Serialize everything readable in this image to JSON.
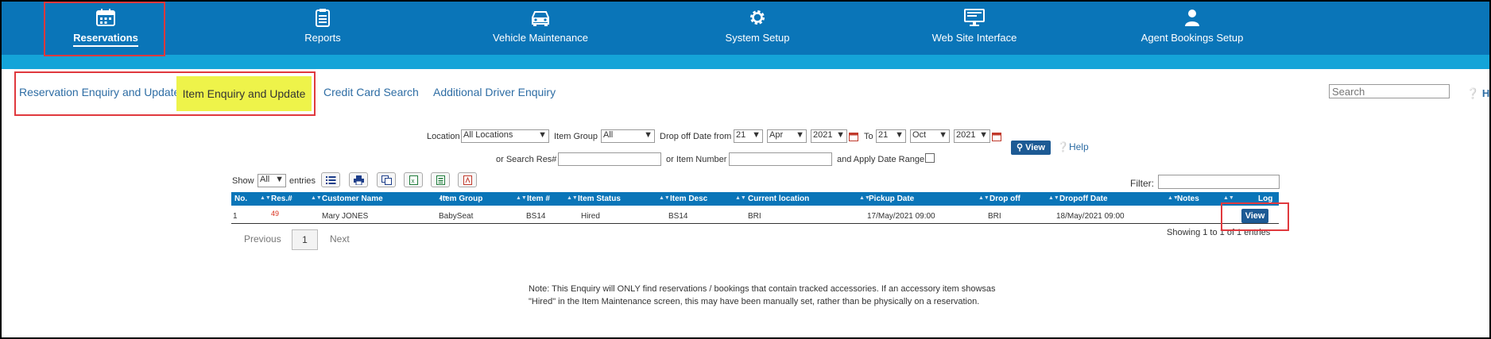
{
  "nav": [
    {
      "label": "Reservations",
      "icon": "calendar-icon",
      "active": true
    },
    {
      "label": "Reports",
      "icon": "clipboard-icon"
    },
    {
      "label": "Vehicle Maintenance",
      "icon": "car-icon"
    },
    {
      "label": "System Setup",
      "icon": "gear-icon"
    },
    {
      "label": "Web Site Interface",
      "icon": "monitor-icon"
    },
    {
      "label": "Agent Bookings Setup",
      "icon": "user-icon"
    }
  ],
  "subtabs": [
    {
      "label": "Reservation Enquiry and Update"
    },
    {
      "label": "Item Enquiry and Update",
      "active": true
    },
    {
      "label": "Credit Card Search"
    },
    {
      "label": "Additional Driver Enquiry"
    }
  ],
  "search": {
    "placeholder": "Search"
  },
  "help_top": "He",
  "form": {
    "location_label": "Location",
    "location_value": "All Locations",
    "item_group_label": "Item Group",
    "item_group_value": "All",
    "dropoff_from_label": "Drop off Date from",
    "from_day": "21",
    "from_month": "Apr",
    "from_year": "2021",
    "to_label": "To",
    "to_day": "21",
    "to_month": "Oct",
    "to_year": "2021",
    "view_label": "View",
    "help_label": "Help",
    "search_res_label": "or Search Res#",
    "item_number_label": "or Item Number",
    "apply_range_label": "and Apply Date Range"
  },
  "table_controls": {
    "show_label": "Show",
    "show_value": "All",
    "entries_label": "entries",
    "filter_label": "Filter:"
  },
  "columns": [
    "No.",
    "Res.#",
    "Customer Name",
    "Item Group",
    "Item #",
    "Item Status",
    "Item Desc",
    "Current location",
    "Pickup Date",
    "Drop off",
    "Dropoff Date",
    "Notes",
    "Log"
  ],
  "rows": [
    {
      "no": "1",
      "res": "49",
      "customer": "Mary JONES",
      "item_group": "BabySeat",
      "item_no": "BS14",
      "status": "Hired",
      "desc": "BS14",
      "location": "BRI",
      "pickup": "17/May/2021 09:00",
      "dropoff": "BRI",
      "dropoff_date": "18/May/2021 09:00",
      "notes": "",
      "action": "View"
    }
  ],
  "pagination": {
    "previous": "Previous",
    "page": "1",
    "next": "Next",
    "showing": "Showing 1 to 1 of 1 entries"
  },
  "note": {
    "line1": "Note: This Enquiry will ONLY find reservations / bookings that contain tracked accessories. If an accessory item showsas",
    "line2": "\"Hired\" in the Item Maintenance screen, this may have been manually set, rather than be physically on a reservation."
  },
  "colors": {
    "nav_bg": "#0a75b8",
    "bar_bg": "#14a4d8",
    "highlight": "#eef34a",
    "annotation": "#e0393e",
    "link": "#2e6da4"
  }
}
